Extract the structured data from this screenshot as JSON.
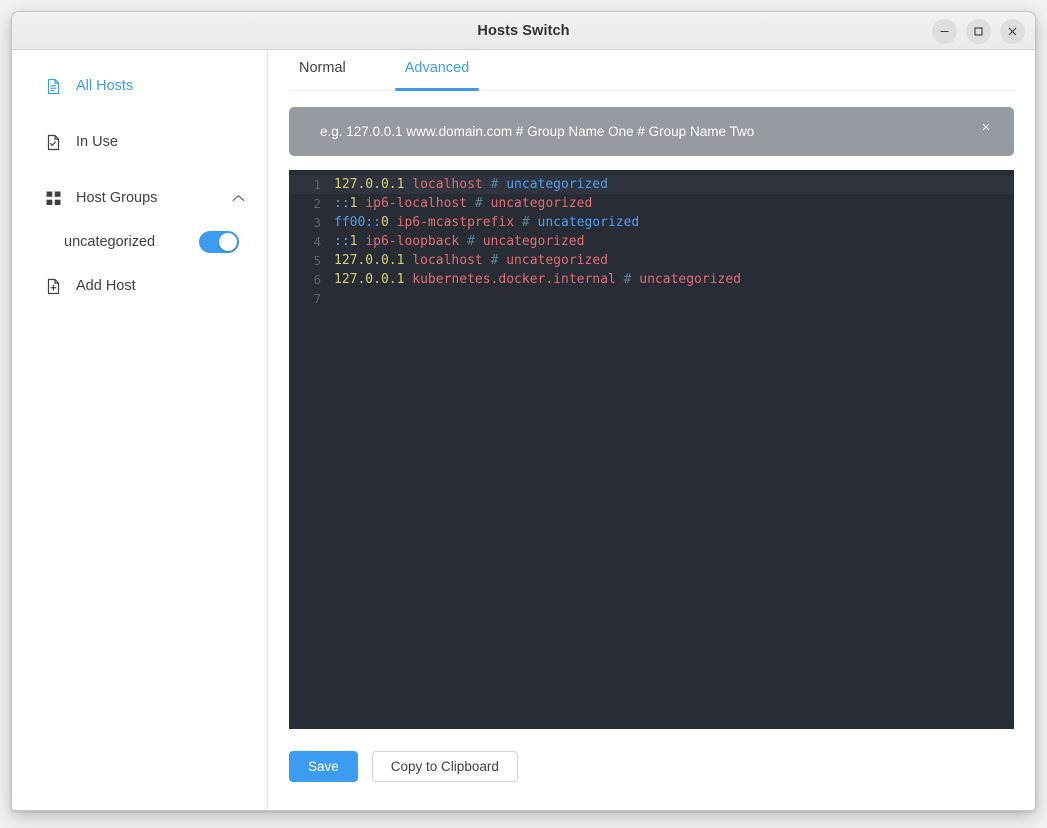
{
  "window": {
    "title": "Hosts Switch",
    "controls": [
      {
        "name": "minimize",
        "glyph": "–"
      },
      {
        "name": "maximize",
        "glyph": "□"
      },
      {
        "name": "close",
        "glyph": "×"
      }
    ]
  },
  "sidebar": {
    "items": [
      {
        "label": "All Hosts",
        "icon": "document-lines-icon",
        "active": true
      },
      {
        "label": "In Use",
        "icon": "document-check-icon",
        "active": false
      },
      {
        "label": "Host Groups",
        "icon": "grid-squares-icon",
        "active": false,
        "expanded": true,
        "chevron": "chevron-up-icon"
      },
      {
        "label": "Add Host",
        "icon": "document-plus-icon",
        "active": false
      }
    ],
    "groups": [
      {
        "label": "uncategorized",
        "enabled": true
      }
    ]
  },
  "main": {
    "tabs": [
      {
        "label": "Normal",
        "active": false
      },
      {
        "label": "Advanced",
        "active": true
      }
    ],
    "hint": {
      "text": "e.g. 127.0.0.1 www.domain.com # Group Name One # Group Name Two",
      "close_label": "×",
      "background": "#9599a0"
    },
    "editor": {
      "background": "#282c34",
      "active_line": 1,
      "lines": [
        {
          "num": "1",
          "tokens": [
            {
              "text": "127.0.0.1",
              "cls": "t-ip"
            },
            {
              "text": " ",
              "cls": "t-plain"
            },
            {
              "text": "localhost",
              "cls": "t-host"
            },
            {
              "text": " ",
              "cls": "t-plain"
            },
            {
              "text": "#",
              "cls": "t-hash"
            },
            {
              "text": " ",
              "cls": "t-plain"
            },
            {
              "text": "uncategorized",
              "cls": "t-grp-blu"
            }
          ]
        },
        {
          "num": "2",
          "tokens": [
            {
              "text": "::",
              "cls": "t-ipb"
            },
            {
              "text": "1",
              "cls": "t-ip"
            },
            {
              "text": " ",
              "cls": "t-plain"
            },
            {
              "text": "ip6-localhost",
              "cls": "t-host"
            },
            {
              "text": " ",
              "cls": "t-plain"
            },
            {
              "text": "#",
              "cls": "t-hash"
            },
            {
              "text": " ",
              "cls": "t-plain"
            },
            {
              "text": "uncategorized",
              "cls": "t-grp-red"
            }
          ]
        },
        {
          "num": "3",
          "tokens": [
            {
              "text": "ff00::",
              "cls": "t-ipb"
            },
            {
              "text": "0",
              "cls": "t-ip"
            },
            {
              "text": " ",
              "cls": "t-plain"
            },
            {
              "text": "ip6-mcastprefix",
              "cls": "t-host"
            },
            {
              "text": " ",
              "cls": "t-plain"
            },
            {
              "text": "#",
              "cls": "t-hash"
            },
            {
              "text": " ",
              "cls": "t-plain"
            },
            {
              "text": "uncategorized",
              "cls": "t-grp-blu"
            }
          ]
        },
        {
          "num": "4",
          "tokens": [
            {
              "text": "::",
              "cls": "t-ipb"
            },
            {
              "text": "1",
              "cls": "t-ip"
            },
            {
              "text": " ",
              "cls": "t-plain"
            },
            {
              "text": "ip6-loopback",
              "cls": "t-host"
            },
            {
              "text": " ",
              "cls": "t-plain"
            },
            {
              "text": "#",
              "cls": "t-hash"
            },
            {
              "text": " ",
              "cls": "t-plain"
            },
            {
              "text": "uncategorized",
              "cls": "t-grp-red"
            }
          ]
        },
        {
          "num": "5",
          "tokens": [
            {
              "text": "127.0.0.1",
              "cls": "t-ip"
            },
            {
              "text": " ",
              "cls": "t-plain"
            },
            {
              "text": "localhost",
              "cls": "t-host"
            },
            {
              "text": " ",
              "cls": "t-plain"
            },
            {
              "text": "#",
              "cls": "t-hash"
            },
            {
              "text": " ",
              "cls": "t-plain"
            },
            {
              "text": "uncategorized",
              "cls": "t-grp-red"
            }
          ]
        },
        {
          "num": "6",
          "tokens": [
            {
              "text": "127.0.0.1",
              "cls": "t-ip"
            },
            {
              "text": " ",
              "cls": "t-plain"
            },
            {
              "text": "kubernetes.docker.internal",
              "cls": "t-host"
            },
            {
              "text": " ",
              "cls": "t-plain"
            },
            {
              "text": "#",
              "cls": "t-hash"
            },
            {
              "text": " ",
              "cls": "t-plain"
            },
            {
              "text": "uncategorized",
              "cls": "t-grp-red"
            }
          ]
        },
        {
          "num": "7",
          "tokens": []
        }
      ]
    },
    "footer": {
      "save_label": "Save",
      "copy_label": "Copy to Clipboard"
    }
  },
  "colors": {
    "accent": "#3b9cf0",
    "editor_bg": "#282c34",
    "hint_bg": "#9599a0"
  }
}
